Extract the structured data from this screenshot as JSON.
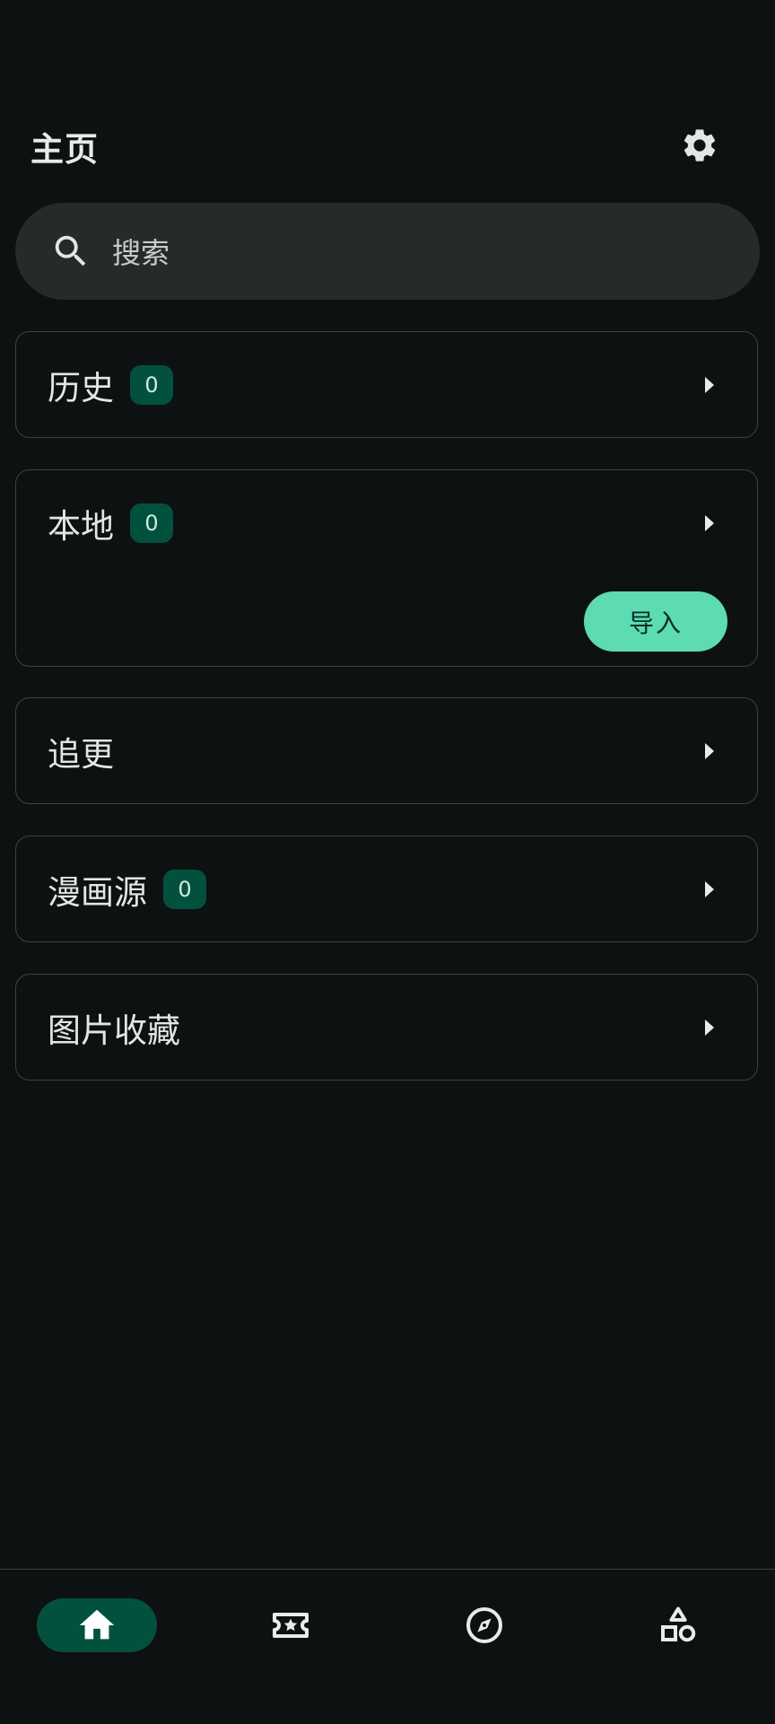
{
  "header": {
    "title": "主页",
    "settings_icon": "gear-icon"
  },
  "search": {
    "placeholder": "搜索",
    "icon": "search-icon"
  },
  "cards": [
    {
      "label": "历史",
      "count": "0"
    },
    {
      "label": "本地",
      "count": "0",
      "action_label": "导入"
    },
    {
      "label": "追更"
    },
    {
      "label": "漫画源",
      "count": "0"
    },
    {
      "label": "图片收藏"
    }
  ],
  "bottom_nav": {
    "items": [
      {
        "icon": "home-icon",
        "active": true
      },
      {
        "icon": "ticket-star-icon",
        "active": false
      },
      {
        "icon": "compass-icon",
        "active": false
      },
      {
        "icon": "shapes-icon",
        "active": false
      }
    ]
  },
  "colors": {
    "background": "#0e1111",
    "accent": "#5ddbb3",
    "badge": "#02513e",
    "search_bg": "#262a29"
  }
}
